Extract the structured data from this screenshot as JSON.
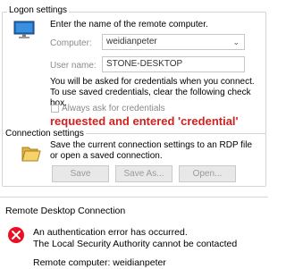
{
  "logon": {
    "group_title": "Logon settings",
    "instruction": "Enter the name of the remote computer.",
    "computer_label": "Computer:",
    "computer_value": "weidianpeter",
    "username_label": "User name:",
    "username_value": "STONE-DESKTOP",
    "credentials_note": "You will be asked for credentials when you connect. To use saved credentials, clear the following check box.",
    "always_ask_label": "Always ask for credentials",
    "always_ask_checked": false
  },
  "annotation": {
    "text": "requested and entered 'credential'",
    "color": "#d42020"
  },
  "connection": {
    "group_title": "Connection settings",
    "description": "Save the current connection settings to an RDP file or open a saved connection.",
    "save_label": "Save",
    "save_as_label": "Save As...",
    "open_label": "Open..."
  },
  "error_dialog": {
    "title": "Remote Desktop Connection",
    "line1": "An authentication error has occurred.",
    "line2": "The Local Security Authority cannot be contacted",
    "remote_computer": "Remote computer: weidianpeter",
    "error_icon": "error-x-icon",
    "error_color": "#e81123"
  },
  "icons": {
    "monitor": "computer-monitor-icon",
    "folder": "folder-icon"
  }
}
